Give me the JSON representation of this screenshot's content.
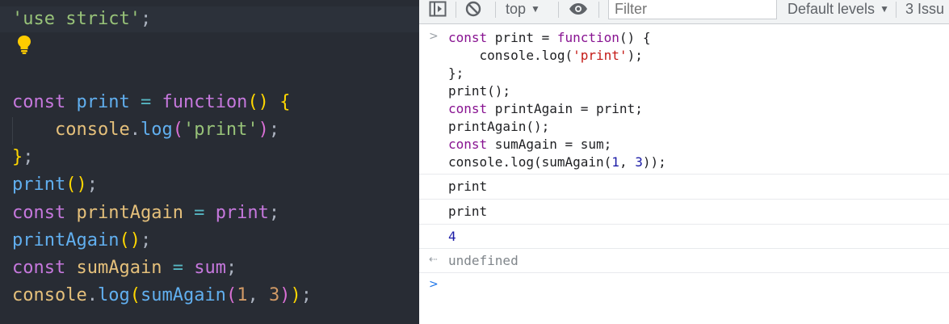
{
  "editor": {
    "lines": [
      {
        "id": "strict",
        "parts": [
          {
            "t": "'use strict'",
            "c": "tok-str"
          },
          {
            "t": ";",
            "c": "tok-punc"
          }
        ]
      },
      {
        "id": "l1",
        "parts": [
          {
            "t": "const ",
            "c": "tok-kw"
          },
          {
            "t": "print",
            "c": "tok-def"
          },
          {
            "t": " = ",
            "c": "tok-op"
          },
          {
            "t": "function",
            "c": "tok-kw"
          },
          {
            "t": "()",
            "c": "tok-paren"
          },
          {
            "t": " ",
            "c": "tok-punc"
          },
          {
            "t": "{",
            "c": "tok-brace"
          }
        ]
      },
      {
        "id": "l2",
        "parts": [
          {
            "t": "    console",
            "c": "tok-obj"
          },
          {
            "t": ".",
            "c": "tok-punc"
          },
          {
            "t": "log",
            "c": "tok-meth"
          },
          {
            "t": "(",
            "c": "tok-paren2"
          },
          {
            "t": "'print'",
            "c": "tok-str"
          },
          {
            "t": ")",
            "c": "tok-paren2"
          },
          {
            "t": ";",
            "c": "tok-punc"
          }
        ]
      },
      {
        "id": "l3",
        "parts": [
          {
            "t": "}",
            "c": "tok-brace"
          },
          {
            "t": ";",
            "c": "tok-punc"
          }
        ]
      },
      {
        "id": "l4",
        "parts": [
          {
            "t": "print",
            "c": "tok-call"
          },
          {
            "t": "()",
            "c": "tok-paren"
          },
          {
            "t": ";",
            "c": "tok-punc"
          }
        ]
      },
      {
        "id": "l5",
        "parts": [
          {
            "t": "const ",
            "c": "tok-kw"
          },
          {
            "t": "printAgain",
            "c": "tok-obj"
          },
          {
            "t": " = ",
            "c": "tok-op"
          },
          {
            "t": "print",
            "c": "tok-fn"
          },
          {
            "t": ";",
            "c": "tok-punc"
          }
        ]
      },
      {
        "id": "l6",
        "parts": [
          {
            "t": "printAgain",
            "c": "tok-call"
          },
          {
            "t": "()",
            "c": "tok-paren"
          },
          {
            "t": ";",
            "c": "tok-punc"
          }
        ]
      },
      {
        "id": "l7",
        "parts": [
          {
            "t": "const ",
            "c": "tok-kw"
          },
          {
            "t": "sumAgain",
            "c": "tok-obj"
          },
          {
            "t": " = ",
            "c": "tok-op"
          },
          {
            "t": "sum",
            "c": "tok-fn"
          },
          {
            "t": ";",
            "c": "tok-punc"
          }
        ]
      },
      {
        "id": "l8",
        "parts": [
          {
            "t": "console",
            "c": "tok-obj"
          },
          {
            "t": ".",
            "c": "tok-punc"
          },
          {
            "t": "log",
            "c": "tok-meth"
          },
          {
            "t": "(",
            "c": "tok-paren"
          },
          {
            "t": "sumAgain",
            "c": "tok-call"
          },
          {
            "t": "(",
            "c": "tok-paren2"
          },
          {
            "t": "1",
            "c": "tok-num"
          },
          {
            "t": ", ",
            "c": "tok-punc"
          },
          {
            "t": "3",
            "c": "tok-num"
          },
          {
            "t": ")",
            "c": "tok-paren2"
          },
          {
            "t": ")",
            "c": "tok-paren"
          },
          {
            "t": ";",
            "c": "tok-punc"
          }
        ]
      }
    ]
  },
  "toolbar": {
    "context": "top",
    "filter_placeholder": "Filter",
    "levels": "Default levels",
    "issues": "3 Issu"
  },
  "console": {
    "input_lines": [
      [
        {
          "t": "const ",
          "c": "c-kw"
        },
        {
          "t": "print = ",
          "c": ""
        },
        {
          "t": "function",
          "c": "c-kw"
        },
        {
          "t": "() {",
          "c": ""
        }
      ],
      [
        {
          "t": "    console.log(",
          "c": ""
        },
        {
          "t": "'print'",
          "c": "c-str"
        },
        {
          "t": ");",
          "c": ""
        }
      ],
      [
        {
          "t": "};",
          "c": ""
        }
      ],
      [
        {
          "t": "print();",
          "c": ""
        }
      ],
      [
        {
          "t": "const ",
          "c": "c-kw"
        },
        {
          "t": "printAgain = print;",
          "c": ""
        }
      ],
      [
        {
          "t": "printAgain();",
          "c": ""
        }
      ],
      [
        {
          "t": "const ",
          "c": "c-kw"
        },
        {
          "t": "sumAgain = sum;",
          "c": ""
        }
      ],
      [
        {
          "t": "console.log(sumAgain(",
          "c": ""
        },
        {
          "t": "1",
          "c": "c-num"
        },
        {
          "t": ", ",
          "c": ""
        },
        {
          "t": "3",
          "c": "c-num"
        },
        {
          "t": "));",
          "c": ""
        }
      ]
    ],
    "outputs": [
      "print",
      "print",
      "4"
    ],
    "result": "undefined"
  }
}
